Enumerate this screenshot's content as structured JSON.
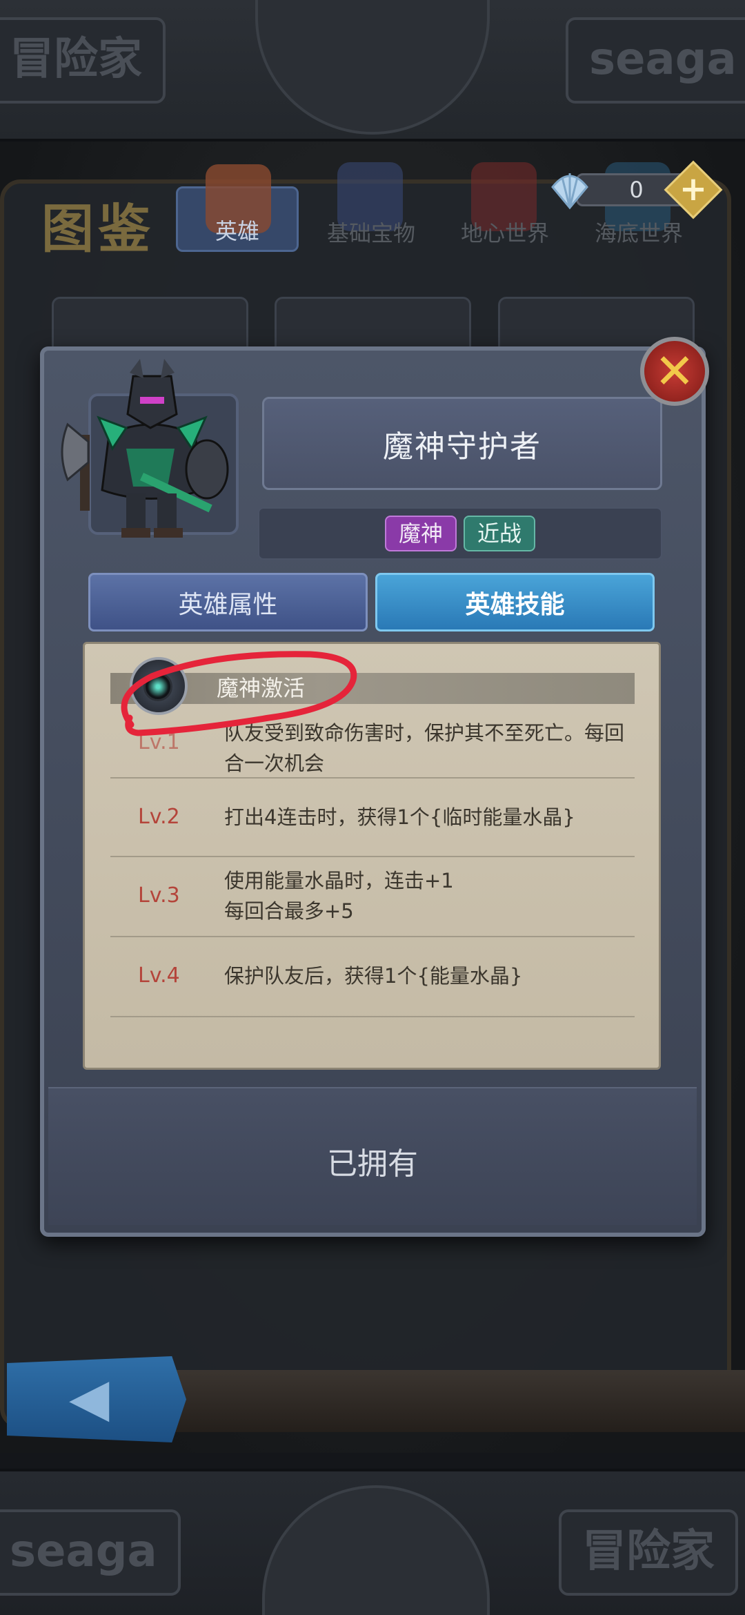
{
  "header": {
    "left_plate_text": "冒险家",
    "right_plate_text": "seaga"
  },
  "album": {
    "title": "图鉴",
    "tabs": [
      {
        "label": "英雄",
        "active": true
      },
      {
        "label": "基础宝物",
        "active": false
      },
      {
        "label": "地心世界",
        "active": false
      },
      {
        "label": "海底世界",
        "active": false
      }
    ],
    "currency": {
      "icon": "shell-icon",
      "value": "0",
      "plus_label": "+"
    }
  },
  "hero": {
    "name": "魔神守护者",
    "tags": [
      {
        "label": "魔神",
        "color": "#8a3aa8"
      },
      {
        "label": "近战",
        "color": "#2f7a6d"
      }
    ]
  },
  "subtabs": {
    "attributes_label": "英雄属性",
    "skills_label": "英雄技能",
    "active": "skills"
  },
  "skill": {
    "name": "魔神激活",
    "levels": [
      {
        "level": "Lv.1",
        "desc": "队友受到致命伤害时，保护其不至死亡。每回合一次机会"
      },
      {
        "level": "Lv.2",
        "desc": "打出4连击时，获得1个{临时能量水晶}"
      },
      {
        "level": "Lv.3",
        "desc": "使用能量水晶时，连击+1\n每回合最多+5"
      },
      {
        "level": "Lv.4",
        "desc": "保护队友后，获得1个{能量水晶}"
      }
    ]
  },
  "status": {
    "owned_label": "已拥有"
  },
  "footer": {
    "left_plate_text": "seaga",
    "right_plate_text": "冒险家"
  },
  "colors": {
    "accent_blue": "#2a79b6",
    "close_red": "#c63b34",
    "level_red": "#b4443a",
    "annotation_red": "#e5243a"
  }
}
